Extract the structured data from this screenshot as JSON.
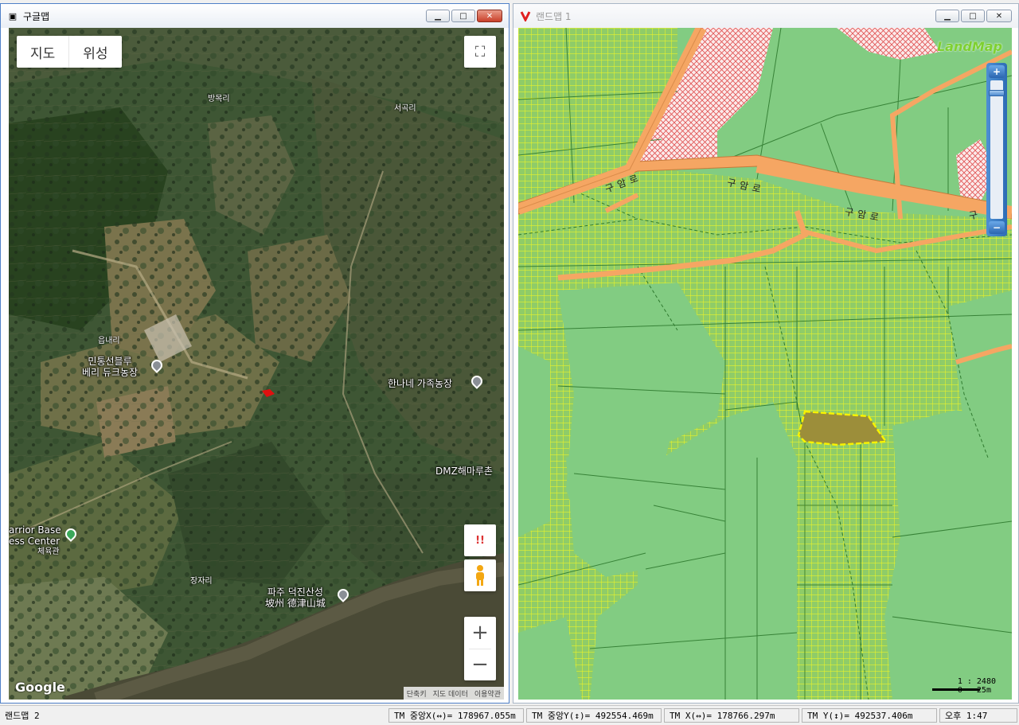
{
  "left_window": {
    "title": "구글맵",
    "map_type": {
      "map_label": "지도",
      "satellite_label": "위성"
    },
    "labels": {
      "bangmok_ri": "방목리",
      "seogok_ri": "서곡리",
      "eupnae_ri": "읍내리",
      "jangja_ri": "장자리",
      "minto_line1": "민통선블루",
      "minto_line2": "베리 듀크농장",
      "hanane": "한나네 가족농장",
      "dmz": "DMZ해마루촌",
      "warrior_line1": "arrior Base",
      "warrior_line2": "ess Center",
      "warrior_line3": "체육관",
      "deokjin_line1": "파주 덕진산성",
      "deokjin_line2": "坡州 德津山城"
    },
    "google_logo": "Google",
    "footer": {
      "shortcuts": "단축키",
      "map_data": "지도 데이터",
      "terms": "이용약관"
    },
    "alert_label": "!!"
  },
  "right_window": {
    "title": "랜드맵 1",
    "logo": "LandMap",
    "road_label_1": "구암로",
    "road_label_2": "구암로",
    "road_label_3": "구암로",
    "road_label_4": "구",
    "scale_ratio": "1 : 2480",
    "scale_bar": "0   25m"
  },
  "status_bar": {
    "window_label": "랜드맵 2",
    "tm_center_x": "TM 중앙X(↔)= 178967.055m",
    "tm_center_y": "TM 중앙Y(↕)= 492554.469m",
    "tm_x": "TM X(↔)= 178766.297m",
    "tm_y": "TM Y(↕)= 492537.406m",
    "time": "오후 1:47"
  }
}
